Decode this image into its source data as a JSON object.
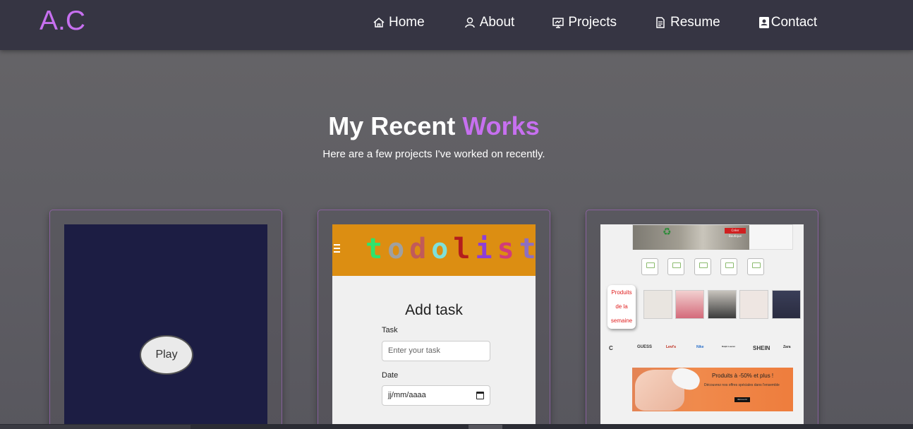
{
  "brand": {
    "logo": "A.C",
    "accent": "#c770f0"
  },
  "nav": {
    "items": [
      {
        "label": "Home",
        "icon": "home-icon"
      },
      {
        "label": "About",
        "icon": "user-icon"
      },
      {
        "label": "Projects",
        "icon": "presentation-icon"
      },
      {
        "label": "Resume",
        "icon": "document-icon"
      },
      {
        "label": "Contact",
        "icon": "contact-card-icon"
      }
    ]
  },
  "section": {
    "title_main": "My Recent",
    "title_accent": "Works",
    "subtitle": "Here are a few projects I've worked on recently."
  },
  "projects": {
    "game": {
      "play_label": "Play"
    },
    "todo": {
      "logo_letters": [
        "t",
        "o",
        "d",
        "o",
        "l",
        "i",
        "s",
        "t"
      ],
      "logo_colors": [
        "#2ee36c",
        "#a0a0a0",
        "#c15a5a",
        "#7fe0d9",
        "#b31d1d",
        "#8e3fd6",
        "#d13c7a",
        "#8e6fc0"
      ],
      "heading": "Add task",
      "task_label": "Task",
      "task_placeholder": "Enter your task",
      "date_label": "Date",
      "date_placeholder": "jj/mm/aaaa"
    },
    "shop": {
      "banner_button": "Créer Boutique",
      "weekly_label_lines": [
        "Produits",
        "de la",
        "semaine"
      ],
      "brands": [
        "C",
        "GUESS",
        "Levi's",
        "Nike",
        "Ralph Lauren",
        "SHEIN",
        "Zara"
      ],
      "sale_title": "Produits à -50% et plus !",
      "sale_text": "Découvrez nos offres spéciales dans l'ensemble",
      "sale_button": "découvrir"
    }
  }
}
